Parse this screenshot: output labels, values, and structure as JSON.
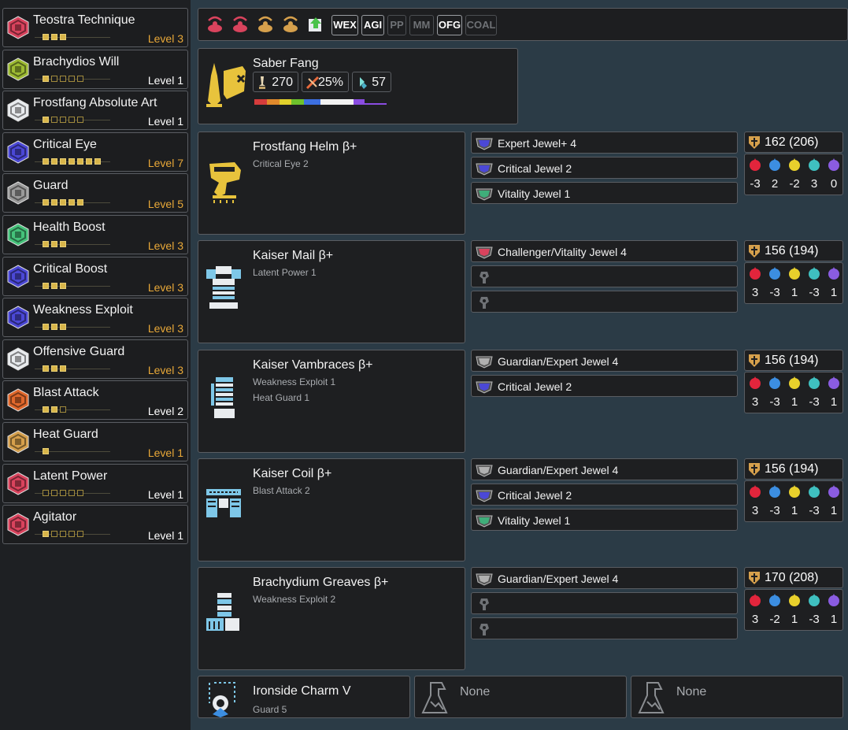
{
  "skills": [
    {
      "name": "Teostra Technique",
      "level": "Level 3",
      "pips": [
        3,
        3
      ],
      "icon_color": "#d9435d",
      "level_color": "#e8a838"
    },
    {
      "name": "Brachydios Will",
      "level": "Level 1",
      "pips": [
        1,
        5
      ],
      "icon_color": "#9dbb33",
      "level_color": "#ffffff"
    },
    {
      "name": "Frostfang Absolute Art",
      "level": "Level 1",
      "pips": [
        1,
        5
      ],
      "icon_color": "#e9ecef",
      "level_color": "#ffffff"
    },
    {
      "name": "Critical Eye",
      "level": "Level 7",
      "pips": [
        7,
        7
      ],
      "icon_color": "#4b48d6",
      "level_color": "#e8a838"
    },
    {
      "name": "Guard",
      "level": "Level 5",
      "pips": [
        5,
        5
      ],
      "icon_color": "#9a9a9a",
      "level_color": "#e8a838"
    },
    {
      "name": "Health Boost",
      "level": "Level 3",
      "pips": [
        3,
        3
      ],
      "icon_color": "#45c27a",
      "level_color": "#e8a838"
    },
    {
      "name": "Critical Boost",
      "level": "Level 3",
      "pips": [
        3,
        3
      ],
      "icon_color": "#4b48d6",
      "level_color": "#e8a838"
    },
    {
      "name": "Weakness Exploit",
      "level": "Level 3",
      "pips": [
        3,
        3
      ],
      "icon_color": "#4b48d6",
      "level_color": "#e8a838"
    },
    {
      "name": "Offensive Guard",
      "level": "Level 3",
      "pips": [
        3,
        3
      ],
      "icon_color": "#e9ecef",
      "level_color": "#e8a838"
    },
    {
      "name": "Blast Attack",
      "level": "Level 2",
      "pips": [
        2,
        3
      ],
      "icon_color": "#e1682c",
      "level_color": "#ffffff"
    },
    {
      "name": "Heat Guard",
      "level": "Level 1",
      "pips": [
        1,
        1
      ],
      "icon_color": "#d6a04c",
      "level_color": "#e8a838"
    },
    {
      "name": "Latent Power",
      "level": "Level 1",
      "pips": [
        0,
        5
      ],
      "icon_color": "#d9435d",
      "level_color": "#ffffff"
    },
    {
      "name": "Agitator",
      "level": "Level 1",
      "pips": [
        1,
        5
      ],
      "icon_color": "#d9435d",
      "level_color": "#ffffff"
    }
  ],
  "toolbar": {
    "icons": [
      "kinsect-icon",
      "kinsect-icon",
      "kinsect-icon",
      "kinsect-icon",
      "kinsect-boost-icon"
    ],
    "buttons": [
      {
        "label": "WEX",
        "active": true
      },
      {
        "label": "AGI",
        "active": true
      },
      {
        "label": "PP",
        "active": false
      },
      {
        "label": "MM",
        "active": false
      },
      {
        "label": "OFG",
        "active": true
      },
      {
        "label": "COAL",
        "active": false
      }
    ]
  },
  "weapon": {
    "name": "Saber Fang",
    "attack": "270",
    "affinity": "25%",
    "element": "57",
    "sharpness": [
      {
        "color": "#d63c3c",
        "frac": 0.09
      },
      {
        "color": "#e18a2c",
        "frac": 0.09
      },
      {
        "color": "#e1d12c",
        "frac": 0.09
      },
      {
        "color": "#6ec12c",
        "frac": 0.09
      },
      {
        "color": "#3c6fe1",
        "frac": 0.12
      },
      {
        "color": "#f2f2f2",
        "frac": 0.24
      },
      {
        "color": "#8a4ce1",
        "frac": 0.08
      },
      {
        "color": "#8a4ce1",
        "frac": 0.16,
        "thin": true
      }
    ]
  },
  "armor": [
    {
      "name": "Frostfang Helm β+",
      "skills": [
        "Critical Eye 2"
      ],
      "icon": "helm-icon",
      "jewels": [
        {
          "name": "Expert Jewel+ 4",
          "color": "#4b48d6"
        },
        {
          "name": "Critical Jewel 2",
          "color": "#4b48d6"
        },
        {
          "name": "Vitality Jewel 1",
          "color": "#3fae7a"
        }
      ],
      "defense": "162  (206)",
      "res": [
        "-3",
        "2",
        "-2",
        "3",
        "0"
      ]
    },
    {
      "name": "Kaiser Mail β+",
      "skills": [
        "Latent Power 1"
      ],
      "icon": "chest-icon",
      "jewels": [
        {
          "name": "Challenger/Vitality Jewel 4",
          "color": "#d9435d"
        },
        {
          "name": "",
          "color": ""
        },
        {
          "name": "",
          "color": ""
        }
      ],
      "defense": "156  (194)",
      "res": [
        "3",
        "-3",
        "1",
        "-3",
        "1"
      ]
    },
    {
      "name": "Kaiser Vambraces β+",
      "skills": [
        "Weakness Exploit 1",
        "Heat Guard 1"
      ],
      "icon": "arms-icon",
      "jewels": [
        {
          "name": "Guardian/Expert Jewel 4",
          "color": "#b0b0b0"
        },
        {
          "name": "Critical Jewel 2",
          "color": "#4b48d6"
        }
      ],
      "defense": "156  (194)",
      "res": [
        "3",
        "-3",
        "1",
        "-3",
        "1"
      ]
    },
    {
      "name": "Kaiser Coil β+",
      "skills": [
        "Blast Attack 2"
      ],
      "icon": "waist-icon",
      "jewels": [
        {
          "name": "Guardian/Expert Jewel 4",
          "color": "#b0b0b0"
        },
        {
          "name": "Critical Jewel 2",
          "color": "#4b48d6"
        },
        {
          "name": "Vitality Jewel 1",
          "color": "#3fae7a"
        }
      ],
      "defense": "156  (194)",
      "res": [
        "3",
        "-3",
        "1",
        "-3",
        "1"
      ]
    },
    {
      "name": "Brachydium Greaves β+",
      "skills": [
        "Weakness Exploit 2"
      ],
      "icon": "legs-icon",
      "jewels": [
        {
          "name": "Guardian/Expert Jewel 4",
          "color": "#b0b0b0"
        },
        {
          "name": "",
          "color": ""
        },
        {
          "name": "",
          "color": ""
        }
      ],
      "defense": "170  (208)",
      "res": [
        "3",
        "-2",
        "1",
        "-3",
        "1"
      ]
    }
  ],
  "charm": {
    "name": "Ironside Charm V",
    "skill": "Guard 5"
  },
  "tools": [
    {
      "label": "None"
    },
    {
      "label": "None"
    }
  ]
}
